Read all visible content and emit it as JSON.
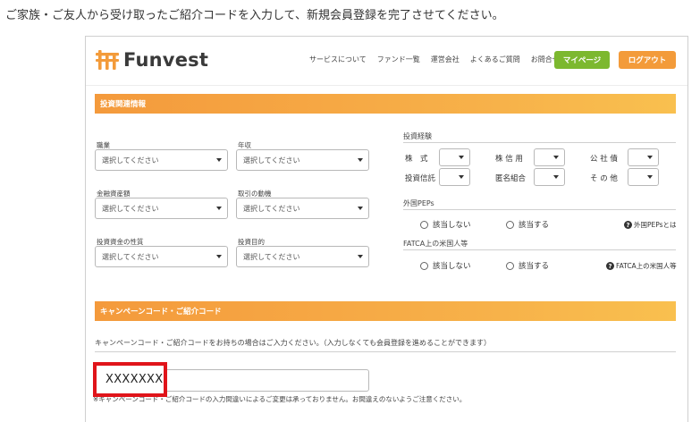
{
  "caption": "ご家族・ご友人から受け取ったご紹介コードを入力して、新規会員登録を完了させてください。",
  "header": {
    "logo_text": "Funvest",
    "nav": [
      "サービスについて",
      "ファンド一覧",
      "運営会社",
      "よくあるご質問",
      "お問合せ"
    ],
    "mypage_label": "マイページ",
    "logout_label": "ログアウト",
    "colors": {
      "mypage": "#7cb82f",
      "logout": "#f39b3a",
      "logo_mark": "#f39b3a"
    }
  },
  "investment": {
    "band_title": "投資関連情報",
    "fields": [
      {
        "label": "職業",
        "value": "選択してください"
      },
      {
        "label": "年収",
        "value": "選択してください"
      },
      {
        "label": "金融資産額",
        "value": "選択してください"
      },
      {
        "label": "取引の動機",
        "value": "選択してください"
      },
      {
        "label": "投資資金の性質",
        "value": "選択してください"
      },
      {
        "label": "投資目的",
        "value": "選択してください"
      }
    ],
    "experience": {
      "title": "投資経験",
      "items": [
        "株　式",
        "株 信 用",
        "公 社 債",
        "投資信託",
        "匿名組合",
        "そ の 他"
      ]
    },
    "peps": {
      "title": "外国PEPs",
      "option_no": "該当しない",
      "option_yes": "該当する",
      "help": "外国PEPsとは"
    },
    "fatca": {
      "title": "FATCA上の米国人等",
      "option_no": "該当しない",
      "option_yes": "該当する",
      "help": "FATCA上の米国人等"
    }
  },
  "campaign": {
    "band_title": "キャンペーンコード・ご紹介コード",
    "description": "キャンペーンコード・ご紹介コードをお持ちの場合はご入力ください。（入力しなくても会員登録を進めることができます）",
    "code_value": "XXXXXXX",
    "note": "※キャンペーンコード・ご紹介コードの入力間違いによるご変更は承っておりません。お間違えのないようご注意ください。"
  }
}
